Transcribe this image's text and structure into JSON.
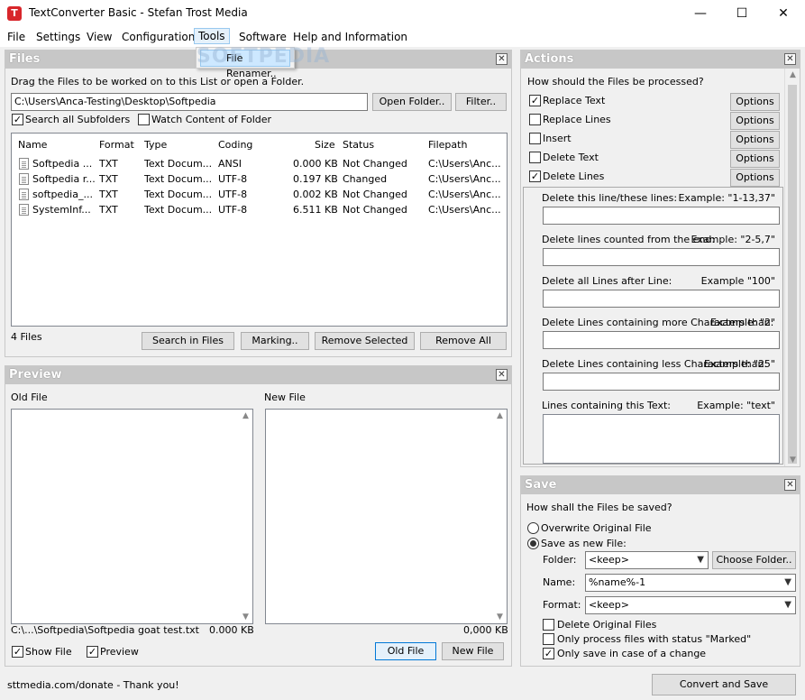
{
  "window": {
    "title": "TextConverter Basic - Stefan Trost Media"
  },
  "menu": [
    "File",
    "Settings",
    "View",
    "Configuration",
    "Tools",
    "Software",
    "Help and Information"
  ],
  "tools_menu": {
    "item": "File Renamer.."
  },
  "files": {
    "header": "Files",
    "instruction": "Drag the Files to be worked on to this List or open a Folder.",
    "path": "C:\\Users\\Anca-Testing\\Desktop\\Softpedia",
    "open_folder": "Open Folder..",
    "filter": "Filter..",
    "search_sub": "Search all Subfolders",
    "watch": "Watch Content of Folder",
    "columns": [
      "Name",
      "Format",
      "Type",
      "Coding",
      "Size",
      "Status",
      "Filepath"
    ],
    "rows": [
      [
        "Softpedia ...",
        "TXT",
        "Text Docum...",
        "ANSI",
        "0.000 KB",
        "Not Changed",
        "C:\\Users\\Anc..."
      ],
      [
        "Softpedia r...",
        "TXT",
        "Text Docum...",
        "UTF-8",
        "0.197 KB",
        "Changed",
        "C:\\Users\\Anc..."
      ],
      [
        "softpedia_...",
        "TXT",
        "Text Docum...",
        "UTF-8",
        "0.002 KB",
        "Not Changed",
        "C:\\Users\\Anc..."
      ],
      [
        "SystemInf...",
        "TXT",
        "Text Docum...",
        "UTF-8",
        "6.511 KB",
        "Not Changed",
        "C:\\Users\\Anc..."
      ]
    ],
    "count": "4 Files",
    "search_in_files": "Search in Files",
    "marking": "Marking..",
    "remove_selected": "Remove Selected",
    "remove_all": "Remove All"
  },
  "preview": {
    "header": "Preview",
    "old_label": "Old File",
    "new_label": "New File",
    "old_path": "C:\\...\\Softpedia\\Softpedia goat test.txt",
    "old_size": "0.000 KB",
    "new_size": "0,000 KB",
    "show_file": "Show File",
    "preview": "Preview",
    "old_btn": "Old File",
    "new_btn": "New File"
  },
  "actions": {
    "header": "Actions",
    "question": "How should the Files be processed?",
    "items": [
      {
        "label": "Replace Text",
        "checked": "✓"
      },
      {
        "label": "Replace Lines",
        "checked": ""
      },
      {
        "label": "Insert",
        "checked": ""
      },
      {
        "label": "Delete Text",
        "checked": ""
      },
      {
        "label": "Delete Lines",
        "checked": "✓"
      }
    ],
    "options": "Options",
    "fields": [
      {
        "label": "Delete this line/these lines:",
        "example": "Example: \"1-13,37\""
      },
      {
        "label": "Delete lines counted from the end:",
        "example": "Example: \"2-5,7\""
      },
      {
        "label": "Delete all Lines after Line:",
        "example": "Example \"100\""
      },
      {
        "label": "Delete Lines containing more Characters than:",
        "example": "Example: \"2\""
      },
      {
        "label": "Delete Lines containing less Characters than:",
        "example": "Example: \"25\""
      },
      {
        "label": "Lines containing this Text:",
        "example": "Example: \"text\""
      }
    ]
  },
  "save": {
    "header": "Save",
    "question": "How shall the Files be saved?",
    "overwrite": "Overwrite Original File",
    "save_new": "Save as new File:",
    "folder_label": "Folder:",
    "folder_value": "<keep>",
    "choose_folder": "Choose Folder..",
    "name_label": "Name:",
    "name_value": "%name%-1",
    "format_label": "Format:",
    "format_value": "<keep>",
    "delete_original": "Delete Original Files",
    "only_marked": "Only process files with status \"Marked\"",
    "only_change": "Only save in case of a change"
  },
  "status": {
    "donate": "sttmedia.com/donate - Thank you!",
    "convert": "Convert and Save"
  },
  "watermark": "SOFTPEDIA"
}
